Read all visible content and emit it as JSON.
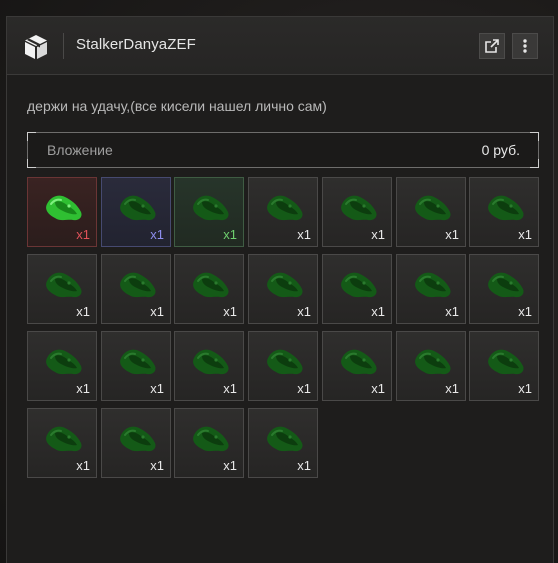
{
  "header": {
    "title": "StalkerDanyaZEF",
    "box_icon": "box-icon",
    "open_icon": "external-link-icon",
    "more_icon": "more-vertical-icon"
  },
  "message": "держи на удачу,(все кисели нашел лично сам)",
  "attachment": {
    "label": "Вложение",
    "amount": "0 руб."
  },
  "items": [
    {
      "rarity": "red",
      "qty": "x1"
    },
    {
      "rarity": "blue",
      "qty": "x1"
    },
    {
      "rarity": "green",
      "qty": "x1"
    },
    {
      "rarity": "common",
      "qty": "x1"
    },
    {
      "rarity": "common",
      "qty": "x1"
    },
    {
      "rarity": "common",
      "qty": "x1"
    },
    {
      "rarity": "common",
      "qty": "x1"
    },
    {
      "rarity": "common",
      "qty": "x1"
    },
    {
      "rarity": "common",
      "qty": "x1"
    },
    {
      "rarity": "common",
      "qty": "x1"
    },
    {
      "rarity": "common",
      "qty": "x1"
    },
    {
      "rarity": "common",
      "qty": "x1"
    },
    {
      "rarity": "common",
      "qty": "x1"
    },
    {
      "rarity": "common",
      "qty": "x1"
    },
    {
      "rarity": "common",
      "qty": "x1"
    },
    {
      "rarity": "common",
      "qty": "x1"
    },
    {
      "rarity": "common",
      "qty": "x1"
    },
    {
      "rarity": "common",
      "qty": "x1"
    },
    {
      "rarity": "common",
      "qty": "x1"
    },
    {
      "rarity": "common",
      "qty": "x1"
    },
    {
      "rarity": "common",
      "qty": "x1"
    },
    {
      "rarity": "common",
      "qty": "x1"
    },
    {
      "rarity": "common",
      "qty": "x1"
    },
    {
      "rarity": "common",
      "qty": "x1"
    },
    {
      "rarity": "common",
      "qty": "x1"
    }
  ],
  "item_icon": "green-artifact-icon",
  "colors": {
    "red_rarity": "#e0525a",
    "blue_rarity": "#8f8ff0",
    "green_rarity": "#6fd06f",
    "artifact_green": "#1f7a22"
  }
}
